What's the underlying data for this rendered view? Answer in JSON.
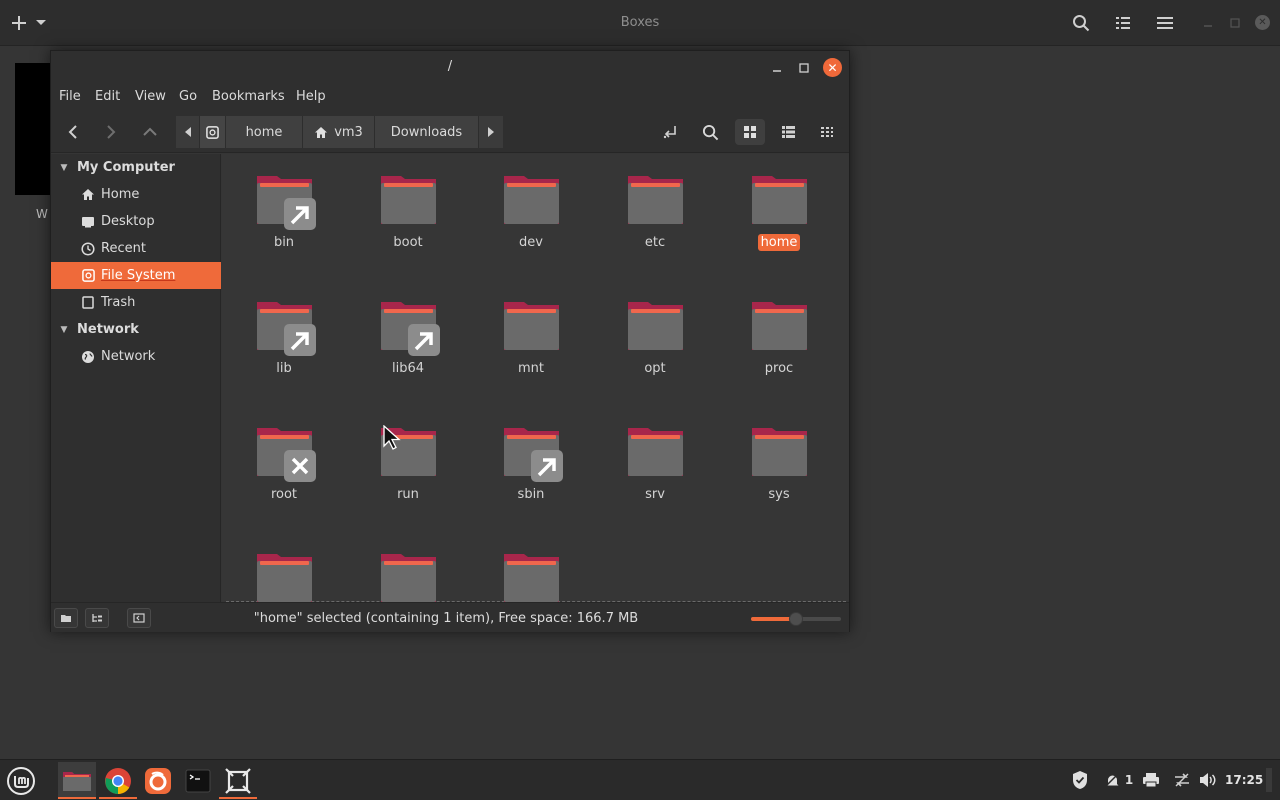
{
  "boxes": {
    "title": "Boxes",
    "thumb_label": "W"
  },
  "window": {
    "title": "/"
  },
  "menu": [
    "File",
    "Edit",
    "View",
    "Go",
    "Bookmarks",
    "Help"
  ],
  "breadcrumb": [
    "home",
    "vm3",
    "Downloads"
  ],
  "sidebar": {
    "sections": [
      {
        "title": "My Computer",
        "items": [
          {
            "label": "Home",
            "icon": "home-icon"
          },
          {
            "label": "Desktop",
            "icon": "desktop-icon"
          },
          {
            "label": "Recent",
            "icon": "recent-icon"
          },
          {
            "label": "File System",
            "icon": "drive-icon",
            "active": true
          },
          {
            "label": "Trash",
            "icon": "trash-icon"
          }
        ]
      },
      {
        "title": "Network",
        "items": [
          {
            "label": "Network",
            "icon": "network-icon"
          }
        ]
      }
    ]
  },
  "files": [
    {
      "name": "bin",
      "emblem": "symlink"
    },
    {
      "name": "boot",
      "emblem": ""
    },
    {
      "name": "dev",
      "emblem": ""
    },
    {
      "name": "etc",
      "emblem": ""
    },
    {
      "name": "home",
      "emblem": "",
      "selected": true
    },
    {
      "name": "lib",
      "emblem": "symlink"
    },
    {
      "name": "lib64",
      "emblem": "symlink"
    },
    {
      "name": "mnt",
      "emblem": ""
    },
    {
      "name": "opt",
      "emblem": ""
    },
    {
      "name": "proc",
      "emblem": ""
    },
    {
      "name": "root",
      "emblem": "no-access"
    },
    {
      "name": "run",
      "emblem": ""
    },
    {
      "name": "sbin",
      "emblem": "symlink"
    },
    {
      "name": "srv",
      "emblem": ""
    },
    {
      "name": "sys",
      "emblem": ""
    },
    {
      "name": "",
      "emblem": ""
    },
    {
      "name": "",
      "emblem": ""
    },
    {
      "name": "",
      "emblem": ""
    }
  ],
  "status": {
    "text": "\"home\" selected (containing 1 item), Free space: 166.7 MB",
    "zoom_fraction": 0.5
  },
  "taskbar": {
    "notifications_count": "1",
    "clock": "17:25"
  },
  "colors": {
    "accent": "#ef6a3a",
    "folder_body": "#6a6a6a",
    "folder_tab": "#a8264b",
    "folder_stripe": "#f0674d"
  }
}
